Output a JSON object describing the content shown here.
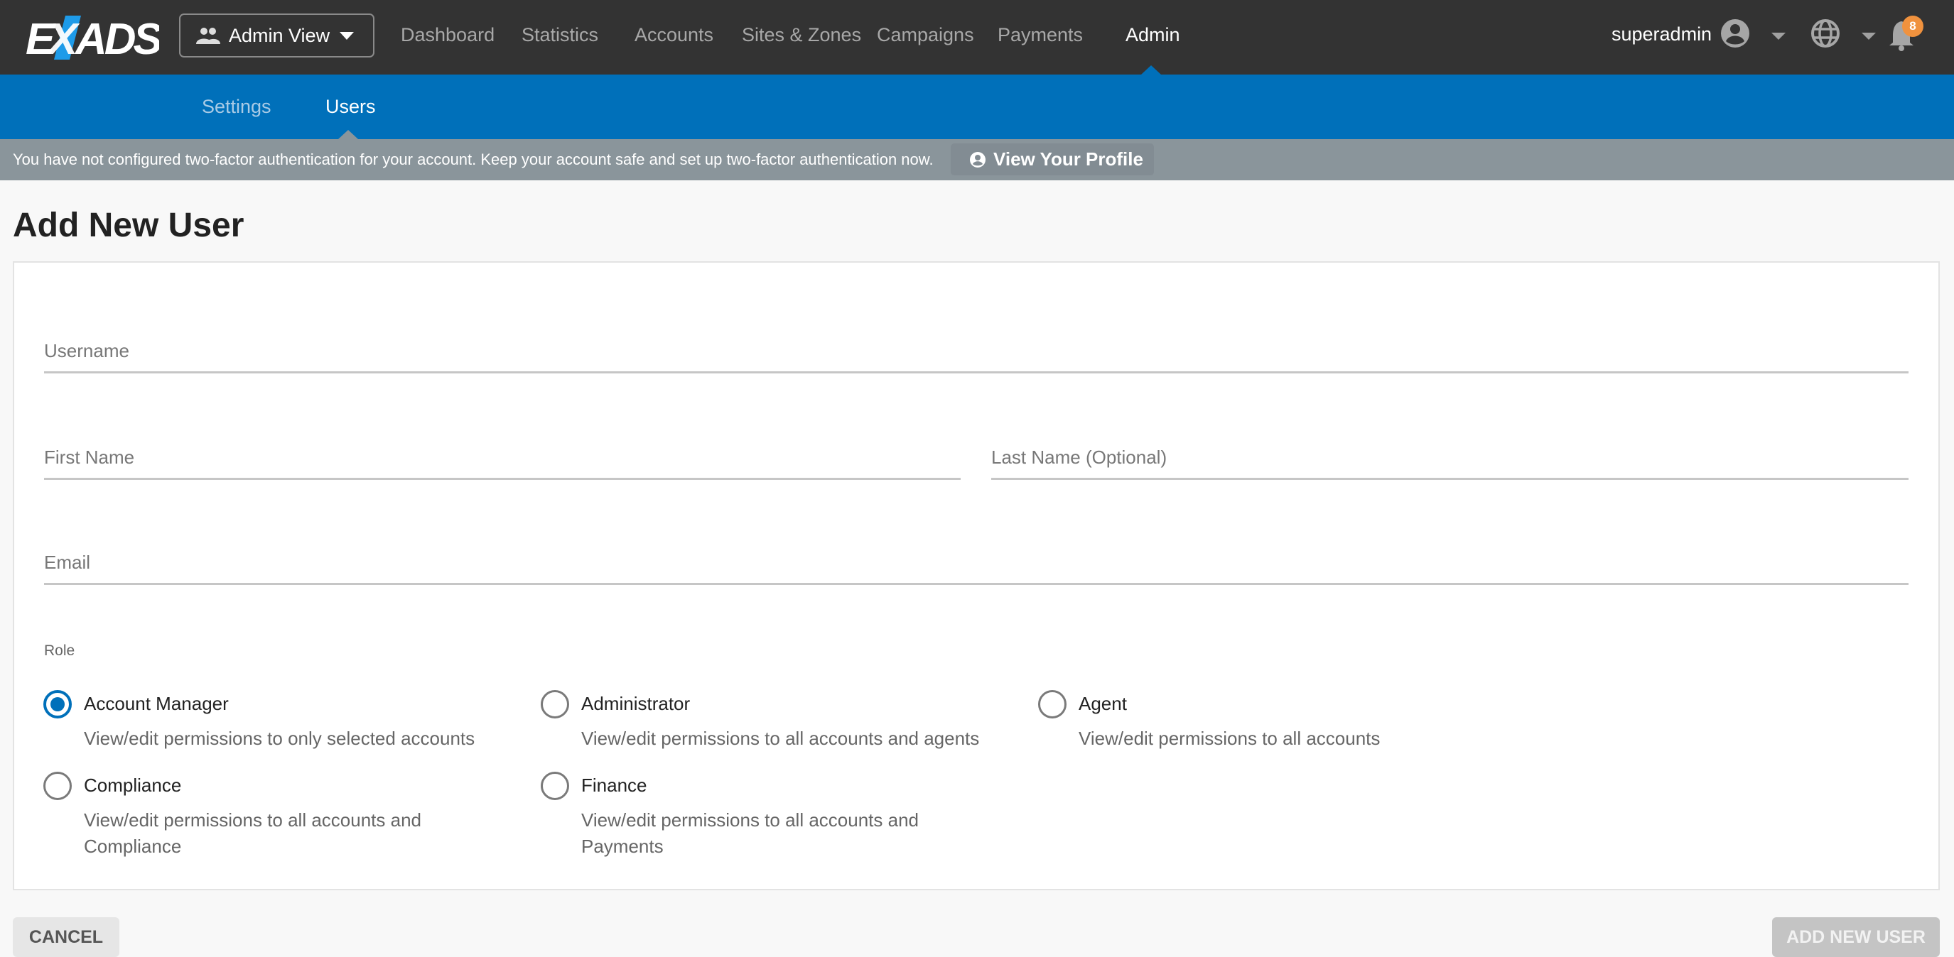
{
  "header": {
    "logo_text": "EXADS",
    "view_switcher_label": "Admin View",
    "nav": [
      {
        "label": "Dashboard",
        "active": false
      },
      {
        "label": "Statistics",
        "active": false
      },
      {
        "label": "Accounts",
        "active": false
      },
      {
        "label": "Sites & Zones",
        "active": false
      },
      {
        "label": "Campaigns",
        "active": false
      },
      {
        "label": "Payments",
        "active": false
      },
      {
        "label": "Admin",
        "active": true
      }
    ],
    "username": "superadmin",
    "notification_count": "8",
    "icons": {
      "view_switcher": "people-icon",
      "user": "account-circle-icon",
      "language": "globe-icon",
      "notifications": "bell-icon"
    }
  },
  "subnav": {
    "tabs": [
      {
        "label": "Settings",
        "active": false
      },
      {
        "label": "Users",
        "active": true
      }
    ]
  },
  "alert": {
    "message": "You have not configured two-factor authentication for your account. Keep your account safe and set up two-factor authentication now.",
    "button_label": "View Your Profile"
  },
  "page": {
    "title": "Add New User"
  },
  "form": {
    "username": {
      "placeholder": "Username",
      "value": ""
    },
    "first_name": {
      "placeholder": "First Name",
      "value": ""
    },
    "last_name": {
      "placeholder": "Last Name (Optional)",
      "value": ""
    },
    "email": {
      "placeholder": "Email",
      "value": ""
    },
    "role_label": "Role",
    "selected_role": "Account Manager",
    "roles": [
      {
        "name": "Account Manager",
        "description": "View/edit permissions to only selected accounts",
        "checked": true
      },
      {
        "name": "Administrator",
        "description": "View/edit permissions to all accounts and agents",
        "checked": false
      },
      {
        "name": "Agent",
        "description": "View/edit permissions to all accounts",
        "checked": false
      },
      {
        "name": "Compliance",
        "description": "View/edit permissions to all accounts and Compliance",
        "checked": false
      },
      {
        "name": "Finance",
        "description": "View/edit permissions to all accounts and Payments",
        "checked": false
      }
    ]
  },
  "actions": {
    "cancel_label": "CANCEL",
    "submit_label": "ADD NEW USER"
  },
  "colors": {
    "header_bg": "#333333",
    "brand_blue": "#0070ba",
    "alert_bg": "#8a959b",
    "badge": "#f0923e",
    "disabled_button": "#c4c4c4"
  }
}
